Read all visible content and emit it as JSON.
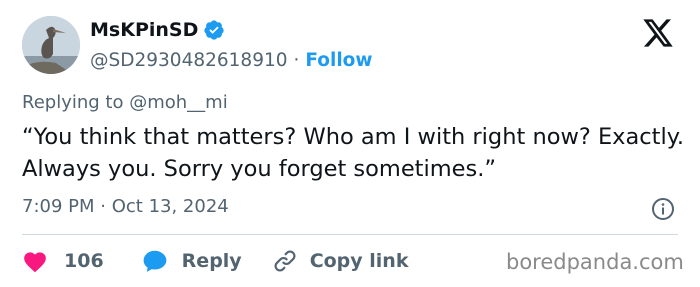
{
  "user": {
    "display_name": "MsKPinSD",
    "handle": "@SD2930482618910",
    "separator": "·",
    "follow_label": "Follow"
  },
  "reply_context": {
    "prefix": "Replying to",
    "mention": "@moh__mi"
  },
  "tweet": {
    "text": "“You think that matters? Who am I with right now? Exactly. Always you. Sorry you forget sometimes.”",
    "time": "7:09 PM",
    "separator": "·",
    "date": "Oct 13, 2024"
  },
  "actions": {
    "like_count": "106",
    "reply_label": "Reply",
    "copy_link_label": "Copy link"
  },
  "watermark": "boredpanda.com",
  "colors": {
    "accent": "#1d9bf0",
    "heart": "#f91880",
    "text_primary": "#0f1419",
    "text_secondary": "#536471",
    "divider": "#cfd9de"
  },
  "icons": [
    "verified-badge-icon",
    "x-logo-icon",
    "info-icon",
    "heart-icon",
    "reply-bubble-icon",
    "link-icon"
  ]
}
